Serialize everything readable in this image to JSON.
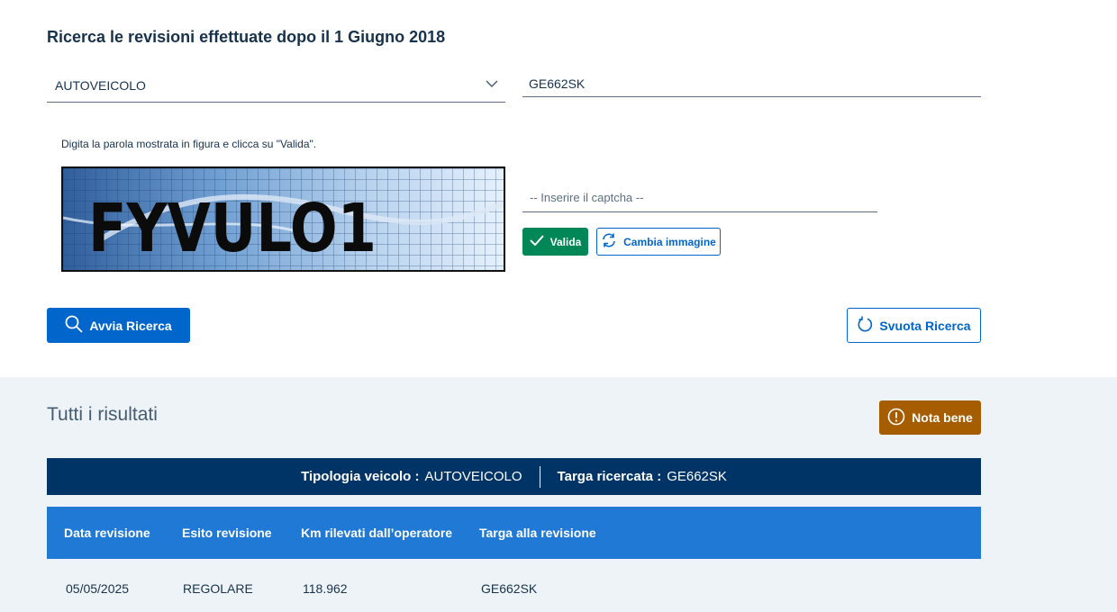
{
  "search": {
    "heading": "Ricerca le revisioni effettuate dopo il 1 Giugno 2018",
    "vehicle_type": "AUTOVEICOLO",
    "plate_value": "GE662SK"
  },
  "captcha": {
    "hint": "Digita la parola mostrata in figura e clicca su \"Valida\".",
    "image_text": "FYVULO1",
    "input_placeholder": "-- Inserire il captcha --",
    "validate_label": "Valida",
    "change_image_label": "Cambia immagine"
  },
  "actions": {
    "search_label": "Avvia Ricerca",
    "clear_label": "Svuota Ricerca"
  },
  "results": {
    "title": "Tutti i risultati",
    "note_label": "Nota bene",
    "summary": {
      "type_label": "Tipologia veicolo :",
      "type_value": "AUTOVEICOLO",
      "plate_label": "Targa ricercata :",
      "plate_value": "GE662SK"
    },
    "columns": [
      "Data revisione",
      "Esito revisione",
      "Km rilevati dall’operatore",
      "Targa alla revisione"
    ],
    "rows": [
      [
        "05/05/2025",
        "REGOLARE",
        "118.962",
        "GE662SK"
      ]
    ]
  },
  "colors": {
    "primary": "#0066cc",
    "success": "#008758",
    "warning": "#a65d00",
    "dark_blue": "#003366",
    "table_header": "#2079d4",
    "results_bg": "#eef3f7"
  },
  "icons": [
    "chevron-down-icon",
    "check-icon",
    "refresh-icon",
    "search-icon",
    "reset-icon",
    "alert-circle-icon"
  ]
}
